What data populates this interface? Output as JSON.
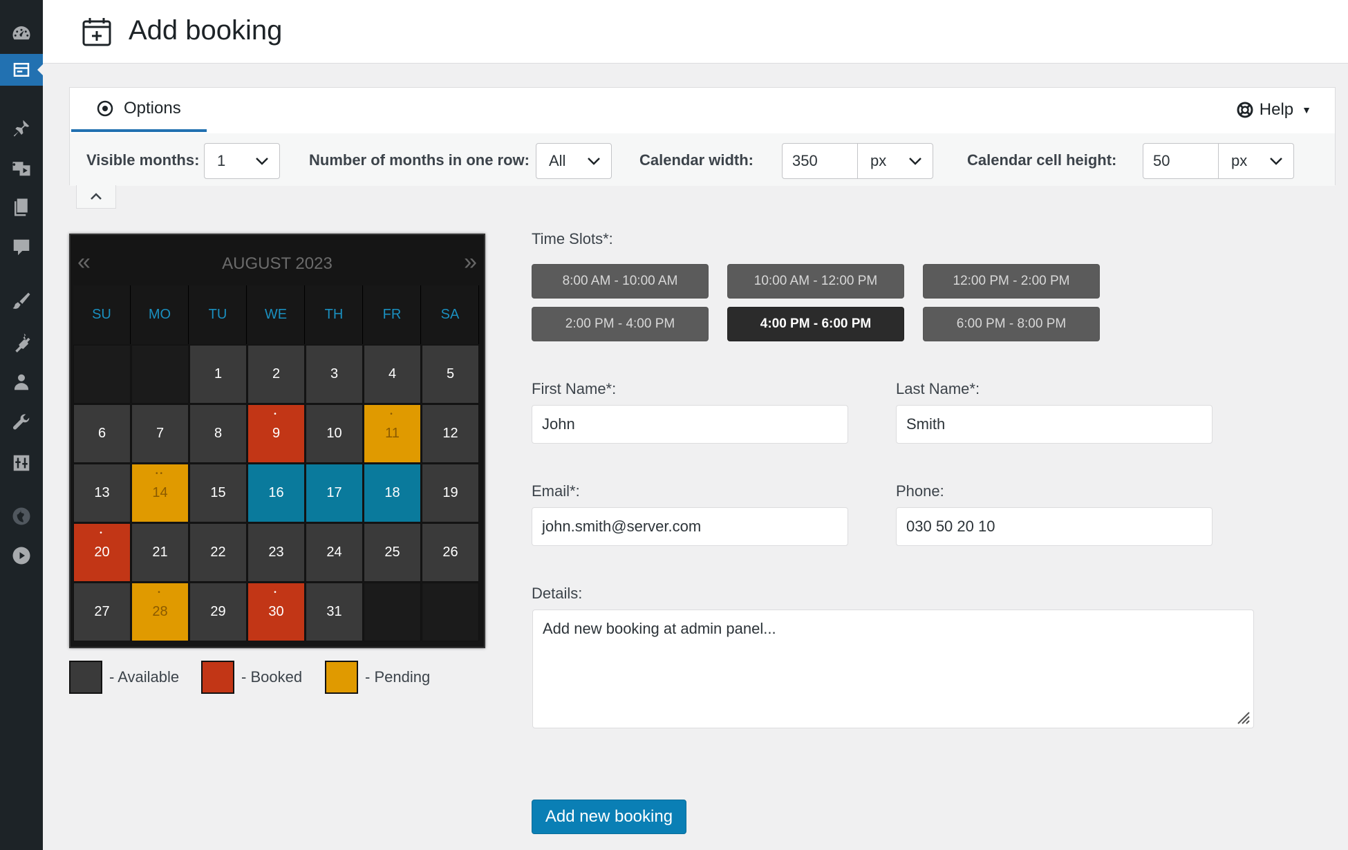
{
  "page": {
    "title": "Add booking"
  },
  "sidebar": {
    "icons": [
      "dashboard-icon",
      "bookings-icon",
      "pin-icon",
      "media-icon",
      "pages-icon",
      "comments-icon",
      "appearance-icon",
      "plugins-icon",
      "users-icon",
      "tools-icon",
      "settings-icon",
      "globe-icon",
      "play-icon"
    ],
    "active": "bookings-icon"
  },
  "tabs": {
    "options": "Options",
    "help": "Help"
  },
  "options": {
    "visible_months_label": "Visible months:",
    "visible_months_value": "1",
    "months_in_row_label": "Number of months in one row:",
    "months_in_row_value": "All",
    "calendar_width_label": "Calendar width:",
    "calendar_width_value": "350",
    "calendar_width_unit": "px",
    "cell_height_label": "Calendar cell height:",
    "cell_height_value": "50",
    "cell_height_unit": "px"
  },
  "calendar": {
    "prev": "«",
    "next": "»",
    "month": "AUGUST 2023",
    "weekdays": [
      "SU",
      "MO",
      "TU",
      "WE",
      "TH",
      "FR",
      "SA"
    ],
    "colors": {
      "available": "#3a3a3a",
      "booked": "#c23616",
      "pending": "#e09a00",
      "selected": "#0a7a9c",
      "empty": "#1b1b1b"
    },
    "days": [
      {
        "d": "",
        "s": "empty"
      },
      {
        "d": "",
        "s": "empty"
      },
      {
        "d": "1",
        "s": "available"
      },
      {
        "d": "2",
        "s": "available"
      },
      {
        "d": "3",
        "s": "available"
      },
      {
        "d": "4",
        "s": "available"
      },
      {
        "d": "5",
        "s": "available"
      },
      {
        "d": "6",
        "s": "available"
      },
      {
        "d": "7",
        "s": "available"
      },
      {
        "d": "8",
        "s": "available"
      },
      {
        "d": "9",
        "s": "booked",
        "dots": "•"
      },
      {
        "d": "10",
        "s": "available"
      },
      {
        "d": "11",
        "s": "pending",
        "dots": "•"
      },
      {
        "d": "12",
        "s": "available"
      },
      {
        "d": "13",
        "s": "available"
      },
      {
        "d": "14",
        "s": "pending",
        "dots": "••"
      },
      {
        "d": "15",
        "s": "available"
      },
      {
        "d": "16",
        "s": "selected"
      },
      {
        "d": "17",
        "s": "selected"
      },
      {
        "d": "18",
        "s": "selected"
      },
      {
        "d": "19",
        "s": "available"
      },
      {
        "d": "20",
        "s": "booked",
        "dots": "•"
      },
      {
        "d": "21",
        "s": "available"
      },
      {
        "d": "22",
        "s": "available"
      },
      {
        "d": "23",
        "s": "available"
      },
      {
        "d": "24",
        "s": "available"
      },
      {
        "d": "25",
        "s": "available"
      },
      {
        "d": "26",
        "s": "available"
      },
      {
        "d": "27",
        "s": "available"
      },
      {
        "d": "28",
        "s": "pending",
        "dots": "•"
      },
      {
        "d": "29",
        "s": "available"
      },
      {
        "d": "30",
        "s": "booked",
        "dots": "•"
      },
      {
        "d": "31",
        "s": "available"
      },
      {
        "d": "",
        "s": "empty"
      },
      {
        "d": "",
        "s": "empty"
      }
    ]
  },
  "legend": {
    "available": "-  Available",
    "booked": "-  Booked",
    "pending": "-  Pending"
  },
  "form": {
    "time_slots_label": "Time Slots*:",
    "slots": [
      "8:00 AM - 10:00 AM",
      "10:00 AM - 12:00 PM",
      "12:00 PM - 2:00 PM",
      "2:00 PM - 4:00 PM",
      "4:00 PM - 6:00 PM",
      "6:00 PM - 8:00 PM"
    ],
    "selected_slot_index": 4,
    "first_name_label": "First Name*:",
    "first_name": "John",
    "last_name_label": "Last Name*:",
    "last_name": "Smith",
    "email_label": "Email*:",
    "email": "john.smith@server.com",
    "phone_label": "Phone:",
    "phone": "030 50 20 10",
    "details_label": "Details:",
    "details": "Add new booking at  admin panel...",
    "submit": "Add new booking"
  }
}
